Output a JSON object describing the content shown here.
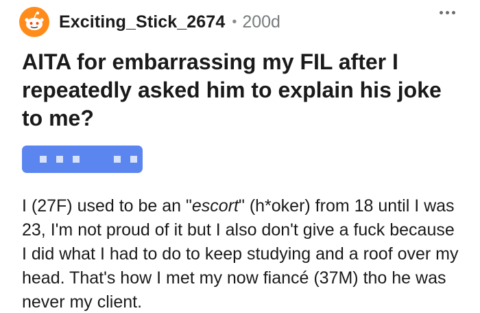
{
  "post": {
    "author": "Exciting_Stick_2674",
    "separator": "•",
    "age": "200d",
    "title": "AITA for embarrassing my FIL after I repeatedly asked him to explain his joke to me?",
    "flair": "",
    "body_before_italic": "I (27F) used to be an \"",
    "body_italic": "escort",
    "body_after_italic": "\" (h*oker) from 18 until I was 23, I'm not proud of it but I also don't give a fuck because I did what I had to do to keep studying and a roof over my head. That's how I met my now fiancé (37M) tho he was never my client."
  },
  "icons": {
    "avatar": "reddit-snoo-avatar-icon",
    "more": "more-options-icon"
  },
  "colors": {
    "avatar_bg": "#ff8c1a",
    "flair_bg": "#5b86f0",
    "text": "#1a1a1b",
    "meta": "#787c7e"
  }
}
